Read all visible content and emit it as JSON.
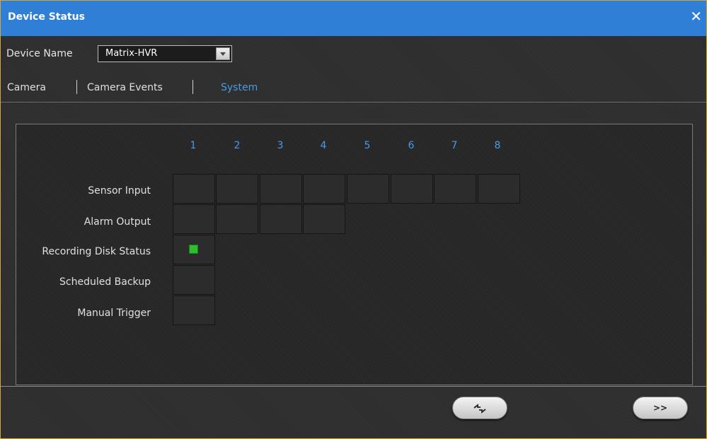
{
  "window": {
    "title": "Device Status",
    "close_glyph": "✕"
  },
  "device": {
    "label": "Device Name",
    "selected": "Matrix-HVR"
  },
  "tabs": [
    {
      "label": "Camera",
      "active": false
    },
    {
      "label": "Camera Events",
      "active": false
    },
    {
      "label": "System",
      "active": true
    }
  ],
  "columns": [
    "1",
    "2",
    "3",
    "4",
    "5",
    "6",
    "7",
    "8"
  ],
  "rows": [
    {
      "label": "Sensor Input",
      "cells": 8
    },
    {
      "label": "Alarm Output",
      "cells": 4
    },
    {
      "label": "Recording Disk Status",
      "cells": 1,
      "indicator": "green"
    },
    {
      "label": "Scheduled Backup",
      "cells": 1
    },
    {
      "label": "Manual Trigger",
      "cells": 1
    }
  ],
  "buttons": {
    "refresh_icon": "refresh-icon",
    "next_label": ">>"
  },
  "colors": {
    "accent": "#4a9ae8",
    "titlebar": "#2f7fd6",
    "status_ok": "#2fbd2f"
  }
}
